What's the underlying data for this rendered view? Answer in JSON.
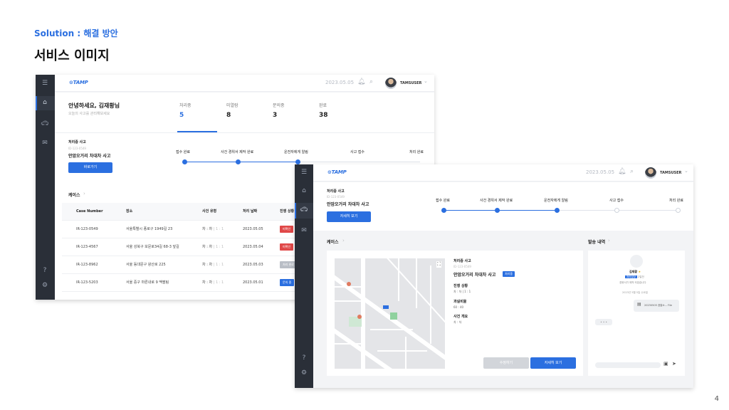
{
  "slide": {
    "subtitle": "Solution : 해결 방안",
    "title": "서비스 이미지",
    "page_number": "4"
  },
  "brand": {
    "logo": "⊙TAMP",
    "accent": "#2b6fe0",
    "sidebar": "#2a2f38"
  },
  "topbar": {
    "date": "2023.05.05",
    "username": "TAMSUSER"
  },
  "dashboard": {
    "greeting": "안녕하세요, 김재황님",
    "greeting_sub": "오늘의 사고를 관리해보세요",
    "stats": [
      {
        "label": "처리중",
        "value": "5"
      },
      {
        "label": "미열람",
        "value": "8"
      },
      {
        "label": "문의중",
        "value": "3"
      },
      {
        "label": "완료",
        "value": "38"
      }
    ],
    "incident_label": "처리중 사고",
    "incident_id": "ID-123-0549",
    "incident_title": "안암오거리 차대차 사고",
    "shortcut_button": "바로가기",
    "steps": [
      "접수 완료",
      "사건 경위서 제작 완료",
      "운전자에게 알림",
      "사고 접수",
      "처리 완료"
    ],
    "cases_label": "케이스",
    "table_headers": [
      "Case Number",
      "장소",
      "사건 유형",
      "처리 날짜",
      "진행 상황"
    ],
    "rows": [
      {
        "id": "IR-123-0549",
        "place": "서울특별시 종로구 1949길 23",
        "type": "차 : 차",
        "type2": "1 : 1",
        "date": "2023.05.05",
        "status": "미확인",
        "color": "#e04848"
      },
      {
        "id": "IR-123-4567",
        "place": "서울 성북구 보문로34길 68-3 앞길",
        "type": "차 : 차",
        "type2": "1 : 1",
        "date": "2023.05.04",
        "status": "미확인",
        "color": "#e04848"
      },
      {
        "id": "IR-123-8962",
        "place": "서울 동대문구 왕산로 225",
        "type": "차 : 차",
        "type2": "1 : 1",
        "date": "2023.05.03",
        "status": "처리 완료",
        "color": "#b9bec6"
      },
      {
        "id": "IR-123-5203",
        "place": "서울 중구 마른내로 9 맥팔림",
        "type": "차 : 차",
        "type2": "1 : 1",
        "date": "2023.05.01",
        "status": "문의 중",
        "color": "#2b6fe0"
      }
    ]
  },
  "detail": {
    "incident_label": "처리중 사고",
    "incident_id": "ID-123-0549",
    "incident_title": "안암오거리 차대차 사고",
    "detail_button": "자세히 보기",
    "steps": [
      "접수 완료",
      "사건 경위서 제작 완료",
      "운전자에게 알림",
      "사고 접수",
      "처리 완료"
    ],
    "cases_label": "케이스",
    "send_label": "발송 내역",
    "case_card": {
      "label": "처리중 사고",
      "id": "ID-123-0549",
      "title": "안암오거리 차대차 사고",
      "tag": "처리중",
      "progress_label": "진행 상황",
      "progress_value": "차 : 차  |  1 : 1",
      "fault_label": "과실비율",
      "fault_value": "60 : 40",
      "summary_label": "사건 개요",
      "summary_value": "차 : 차",
      "edit_button": "수정하기",
      "detail_button": "자세히 보기"
    },
    "chat": {
      "name": "김재황",
      "tag": "처리담당",
      "tag2": "2일전",
      "msg": "경위서가 제작 되었습니다",
      "time": "2023년 5월 5일 수요일",
      "file": "20230505 경찰소...  File",
      "typing": "• • •"
    }
  }
}
